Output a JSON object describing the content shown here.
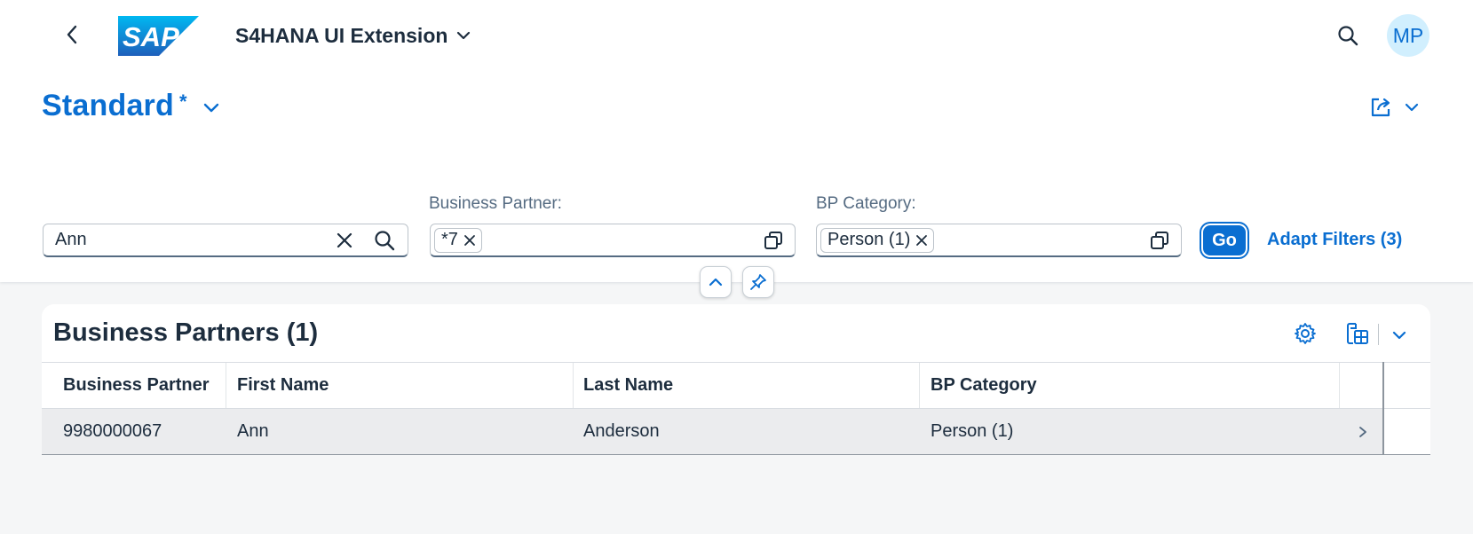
{
  "shell": {
    "logo_text": "SAP",
    "app_title": "S4HANA UI Extension",
    "avatar_initials": "MP"
  },
  "variant": {
    "name": "Standard",
    "modified_marker": "*"
  },
  "filters": {
    "search_value": "Ann",
    "business_partner": {
      "label": "Business Partner:",
      "token": "*7"
    },
    "bp_category": {
      "label": "BP Category:",
      "token": "Person (1)"
    },
    "go_label": "Go",
    "adapt_label": "Adapt Filters (3)"
  },
  "table": {
    "title": "Business Partners (1)",
    "columns": [
      "Business Partner",
      "First Name",
      "Last Name",
      "BP Category"
    ],
    "rows": [
      [
        "9980000067",
        "Ann",
        "Anderson",
        "Person (1)"
      ]
    ]
  },
  "colors": {
    "brand_blue": "#0a6ed1",
    "text": "#1d2d3e",
    "label": "#556b82",
    "background": "#f5f6f7",
    "avatar_bg": "#d1effe"
  }
}
